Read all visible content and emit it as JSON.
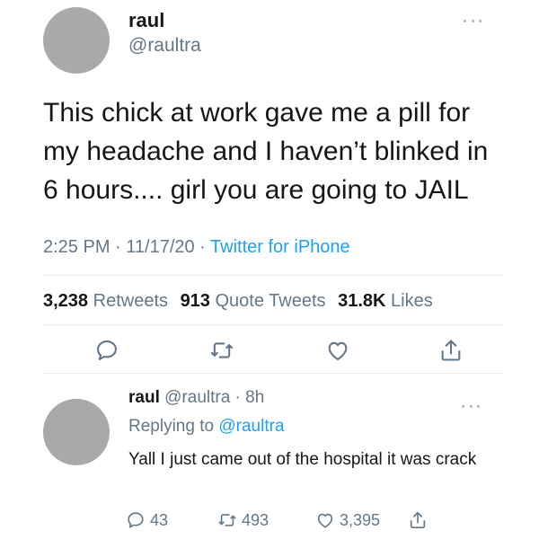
{
  "main_tweet": {
    "display_name": "raul",
    "handle": "@raultra",
    "text": "This chick at work gave me a pill for my headache and I haven’t blinked in 6 hours.... girl you are going to JAIL",
    "timestamp": "2:25 PM · 11/17/20 · ",
    "source": "Twitter for iPhone",
    "stats": {
      "retweets_count": "3,238",
      "retweets_label": "Retweets",
      "quotes_count": "913",
      "quotes_label": "Quote Tweets",
      "likes_count": "31.8K",
      "likes_label": "Likes"
    },
    "icons": [
      "reply-icon",
      "retweet-icon",
      "like-icon",
      "share-icon"
    ]
  },
  "reply_tweet": {
    "display_name": "raul",
    "handle_time": " @raultra · 8h",
    "replying_prefix": "Replying to ",
    "replying_to": "@raultra",
    "text": "Yall I just came out of the hospital it was crack",
    "reply_count": "43",
    "retweet_count": "493",
    "like_count": "3,395"
  },
  "colors": {
    "accent": "#1da1f2",
    "secondary_text": "#657786",
    "icon": "#657786",
    "avatar": "#a9a9a9"
  }
}
